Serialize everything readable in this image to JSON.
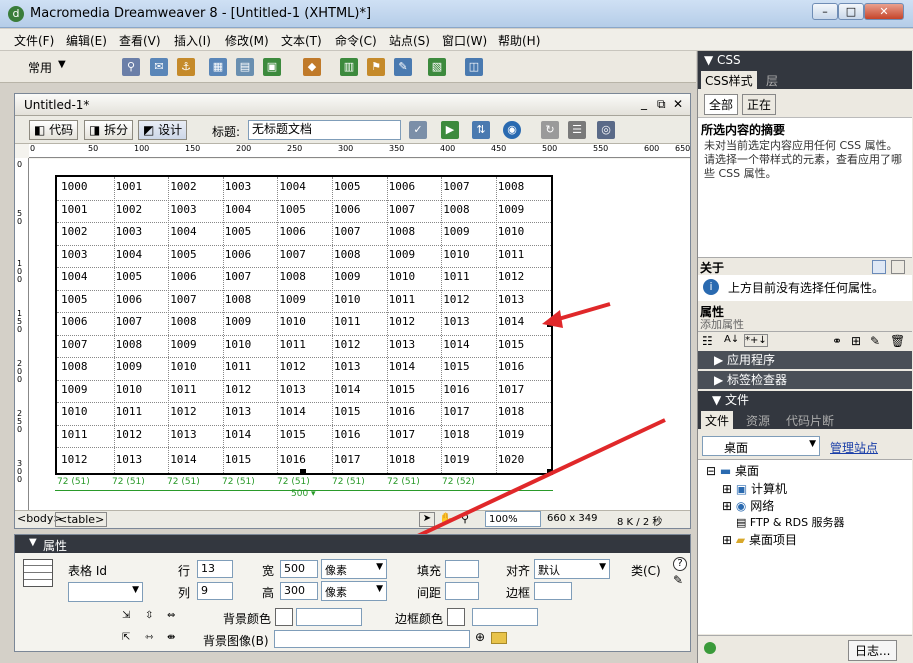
{
  "window": {
    "title": "Macromedia Dreamweaver 8 - [Untitled-1 (XHTML)*]",
    "buttons": [
      "–",
      "□",
      "✕"
    ]
  },
  "menu": [
    "文件(F)",
    "编辑(E)",
    "查看(V)",
    "插入(I)",
    "修改(M)",
    "文本(T)",
    "命令(C)",
    "站点(S)",
    "窗口(W)",
    "帮助(H)"
  ],
  "toolbar": {
    "category": "常用"
  },
  "document": {
    "tab": "Untitled-1*",
    "win_controls": [
      "_",
      "⧉",
      "✕"
    ],
    "views": [
      "代码",
      "拆分",
      "设计"
    ],
    "title_label": "标题:",
    "title_value": "无标题文档"
  },
  "ruler": {
    "top": [
      "0",
      "50",
      "100",
      "150",
      "200",
      "250",
      "300",
      "350",
      "400",
      "450",
      "500",
      "550",
      "600",
      "650"
    ],
    "left": [
      "0",
      "50",
      "100",
      "150",
      "200",
      "250",
      "300"
    ]
  },
  "table": {
    "rows": [
      [
        "1000",
        "1001",
        "1002",
        "1003",
        "1004",
        "1005",
        "1006",
        "1007",
        "1008"
      ],
      [
        "1001",
        "1002",
        "1003",
        "1004",
        "1005",
        "1006",
        "1007",
        "1008",
        "1009"
      ],
      [
        "1002",
        "1003",
        "1004",
        "1005",
        "1006",
        "1007",
        "1008",
        "1009",
        "1010"
      ],
      [
        "1003",
        "1004",
        "1005",
        "1006",
        "1007",
        "1008",
        "1009",
        "1010",
        "1011"
      ],
      [
        "1004",
        "1005",
        "1006",
        "1007",
        "1008",
        "1009",
        "1010",
        "1011",
        "1012"
      ],
      [
        "1005",
        "1006",
        "1007",
        "1008",
        "1009",
        "1010",
        "1011",
        "1012",
        "1013"
      ],
      [
        "1006",
        "1007",
        "1008",
        "1009",
        "1010",
        "1011",
        "1012",
        "1013",
        "1014"
      ],
      [
        "1007",
        "1008",
        "1009",
        "1010",
        "1011",
        "1012",
        "1013",
        "1014",
        "1015"
      ],
      [
        "1008",
        "1009",
        "1010",
        "1011",
        "1012",
        "1013",
        "1014",
        "1015",
        "1016"
      ],
      [
        "1009",
        "1010",
        "1011",
        "1012",
        "1013",
        "1014",
        "1015",
        "1016",
        "1017"
      ],
      [
        "1010",
        "1011",
        "1012",
        "1013",
        "1014",
        "1015",
        "1016",
        "1017",
        "1018"
      ],
      [
        "1011",
        "1012",
        "1013",
        "1014",
        "1015",
        "1016",
        "1017",
        "1018",
        "1019"
      ],
      [
        "1012",
        "1013",
        "1014",
        "1015",
        "1016",
        "1017",
        "1018",
        "1019",
        "1020"
      ]
    ],
    "col_widths": [
      "72 (51)",
      "72 (51)",
      "72 (51)",
      "72 (51)",
      "72 (51)",
      "72 (51)",
      "72 (51)",
      "72 (52)"
    ],
    "total_width": "500"
  },
  "status": {
    "tags": [
      "<body>",
      "<table>"
    ],
    "zoom": "100%",
    "size": "660 x 349",
    "weight": "8 K / 2 秒"
  },
  "properties": {
    "title": "属性",
    "label_table": "表格 Id",
    "rows_label": "行",
    "rows": "13",
    "cols_label": "列",
    "cols": "9",
    "w_label": "宽",
    "w": "500",
    "w_unit": "像素",
    "h_label": "高",
    "h": "300",
    "h_unit": "像素",
    "pad_label": "填充",
    "space_label": "间距",
    "align_label": "对齐",
    "align": "默认",
    "border_label": "边框",
    "class_label": "类(C)",
    "bgcolor_label": "背景颜色",
    "bordercolor_label": "边框颜色",
    "bgimage_label": "背景图像(B)"
  },
  "panel": {
    "css_title": "CSS",
    "css_tabs": [
      "CSS样式",
      "层"
    ],
    "modes": [
      "全部",
      "正在"
    ],
    "summary_title": "所选内容的摘要",
    "summary_text": "未对当前选定内容应用任何 CSS 属性。请选择一个带样式的元素，查看应用了哪些 CSS 属性。",
    "about_title": "关于",
    "about_text": "上方目前没有选择任何属性。",
    "attr_title": "属性",
    "attr_add": "添加属性",
    "groups": [
      "应用程序",
      "标签检查器"
    ],
    "files_title": "文件",
    "files_tabs": [
      "文件",
      "资源",
      "代码片断"
    ],
    "site": "桌面",
    "manage": "管理站点",
    "tree": [
      "桌面",
      "计算机",
      "网络",
      "FTP & RDS 服务器",
      "桌面项目"
    ],
    "log": "日志..."
  },
  "colors": {
    "accent": "#33373f",
    "annotation": "#e0282a",
    "green": "#2a9a2a"
  }
}
